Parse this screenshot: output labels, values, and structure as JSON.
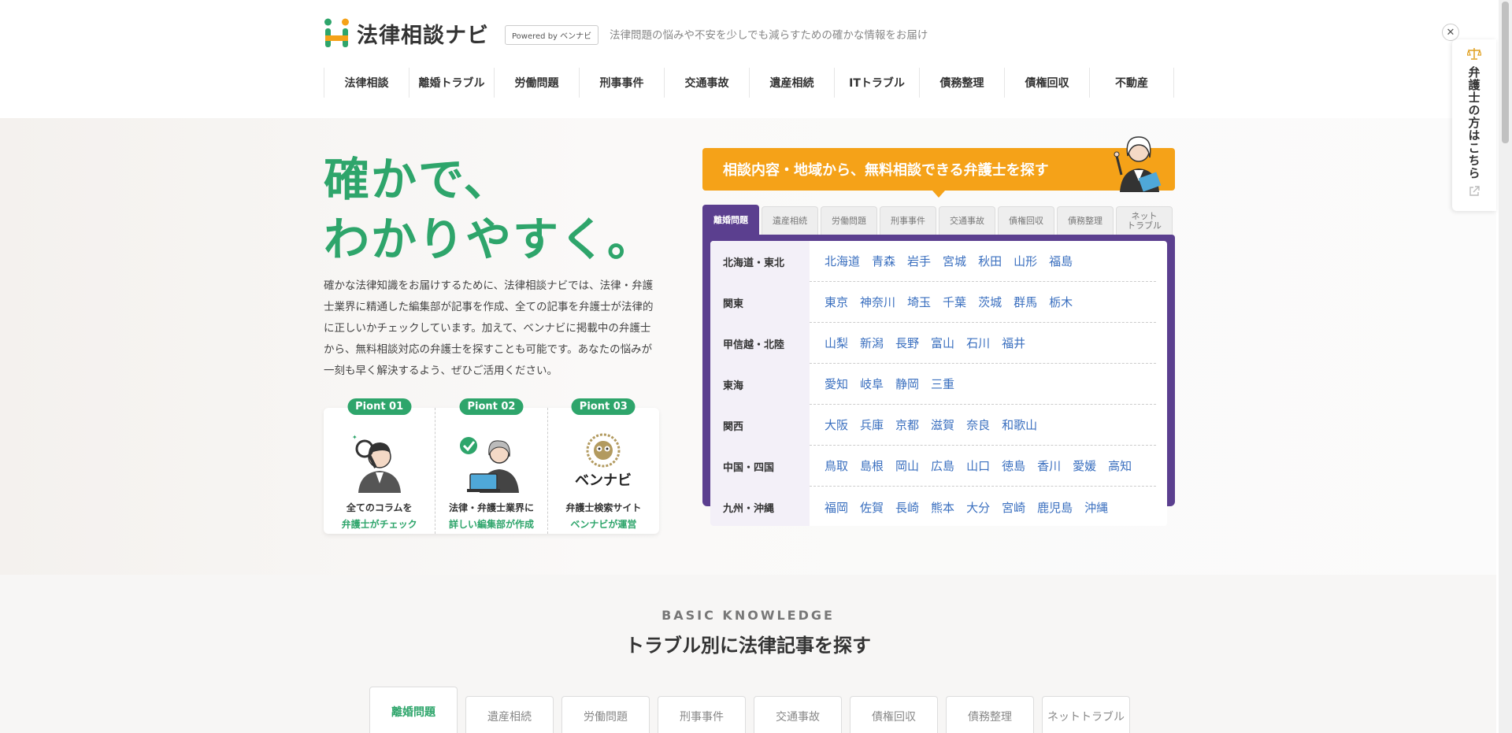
{
  "header": {
    "logo_text": "法律相談ナビ",
    "powered": "Powered by ベンナビ",
    "tagline": "法律問題の悩みや不安を少しでも減らすための確かな情報をお届け"
  },
  "nav": [
    "法律相談",
    "離婚トラブル",
    "労働問題",
    "刑事事件",
    "交通事故",
    "遺産相続",
    "ITトラブル",
    "債務整理",
    "債権回収",
    "不動産"
  ],
  "hero": {
    "title_line1": "確かで、",
    "title_line2": "わかりやすく。",
    "description": "確かな法律知識をお届けするために、法律相談ナビでは、法律・弁護士業界に精通した編集部が記事を作成、全ての記事を弁護士が法律的に正しいかチェックしています。加えて、ベンナビに掲載中の弁護士から、無料相談対応の弁護士を探すことも可能です。あなたの悩みが一刻も早く解決するよう、ぜひご活用ください。",
    "points": [
      {
        "badge": "Piont 01",
        "line1": "全てのコラムを",
        "line2": "弁護士がチェック",
        "icon": "magnifier-lawyer-icon"
      },
      {
        "badge": "Piont 02",
        "line1": "法律・弁護士業界に",
        "line2": "詳しい編集部が作成",
        "icon": "editor-laptop-icon"
      },
      {
        "badge": "Piont 03",
        "line1": "弁護士検索サイト",
        "line2": "ベンナビが運営",
        "icon": "bennavi-owl-icon",
        "logo_text": "ベンナビ"
      }
    ]
  },
  "search": {
    "banner": "相談内容・地域から、無料相談できる弁護士を探す",
    "tabs": [
      "離婚問題",
      "遺産相続",
      "労働問題",
      "刑事事件",
      "交通事故",
      "債権回収",
      "債務整理",
      "ネット\nトラブル"
    ],
    "active_tab": 0,
    "regions": [
      {
        "name": "北海道・東北",
        "prefs": [
          "北海道",
          "青森",
          "岩手",
          "宮城",
          "秋田",
          "山形",
          "福島"
        ]
      },
      {
        "name": "関東",
        "prefs": [
          "東京",
          "神奈川",
          "埼玉",
          "千葉",
          "茨城",
          "群馬",
          "栃木"
        ]
      },
      {
        "name": "甲信越・北陸",
        "prefs": [
          "山梨",
          "新潟",
          "長野",
          "富山",
          "石川",
          "福井"
        ]
      },
      {
        "name": "東海",
        "prefs": [
          "愛知",
          "岐阜",
          "静岡",
          "三重"
        ]
      },
      {
        "name": "関西",
        "prefs": [
          "大阪",
          "兵庫",
          "京都",
          "滋賀",
          "奈良",
          "和歌山"
        ]
      },
      {
        "name": "中国・四国",
        "prefs": [
          "鳥取",
          "島根",
          "岡山",
          "広島",
          "山口",
          "徳島",
          "香川",
          "愛媛",
          "高知"
        ]
      },
      {
        "name": "九州・沖縄",
        "prefs": [
          "福岡",
          "佐賀",
          "長崎",
          "熊本",
          "大分",
          "宮崎",
          "鹿児島",
          "沖縄"
        ]
      }
    ]
  },
  "side": {
    "text": "弁護士の方はこちら",
    "close": "✕"
  },
  "basic": {
    "eyebrow": "BASIC KNOWLEDGE",
    "title": "トラブル別に法律記事を探す",
    "tabs": [
      "離婚問題",
      "遺産相続",
      "労働問題",
      "刑事事件",
      "交通事故",
      "債権回収",
      "債務整理",
      "ネットトラブル"
    ],
    "active_tab": 0
  },
  "colors": {
    "brand_green": "#2ea56b",
    "accent_orange": "#f5a218",
    "purple": "#5b3f8f",
    "link_blue": "#3a6fbf"
  }
}
